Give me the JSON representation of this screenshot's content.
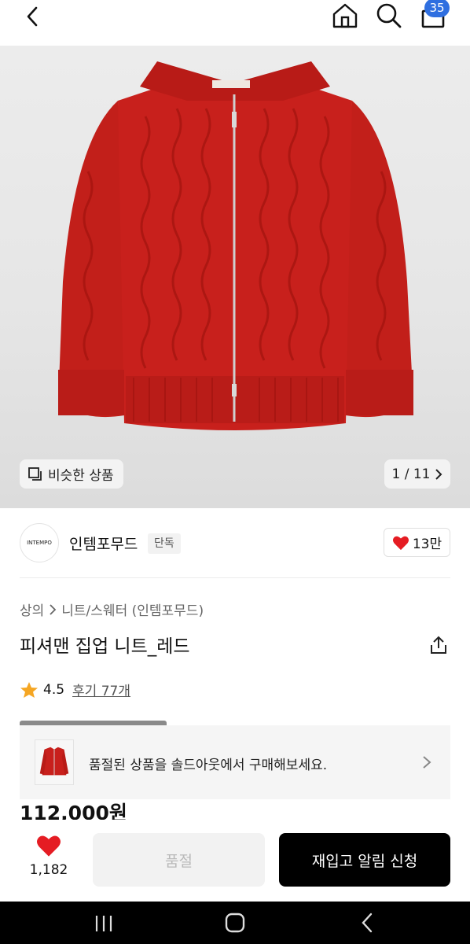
{
  "header": {
    "back_icon": "back-chevron-icon",
    "home_icon": "home-icon",
    "search_icon": "search-icon",
    "cart_icon": "shopping-bag-icon",
    "cart_count": "35"
  },
  "gallery": {
    "similar_label": "비슷한 상품",
    "page_indicator": "1 / 11",
    "product_color": "#c8201c"
  },
  "brand": {
    "logo_text": "INTEMPO",
    "name": "인템포무드",
    "badge": "단독",
    "likes": "13만"
  },
  "breadcrumb": {
    "category": "상의",
    "subcategory": "니트/스웨터 (인템포무드)"
  },
  "product": {
    "title": "피셔맨 집업 니트_레드",
    "rating": "4.5",
    "review_label": "후기 77개",
    "price": "112,000원"
  },
  "soldout_banner": {
    "message": "품절된 상품을 솔드아웃에서 구매해보세요."
  },
  "actions": {
    "favorite_count": "1,182",
    "soldout_label": "품절",
    "restock_label": "재입고 알림 신청"
  },
  "colors": {
    "accent_blue": "#2f6fe0",
    "heart_red": "#e51c23",
    "star_orange": "#f5a623"
  }
}
